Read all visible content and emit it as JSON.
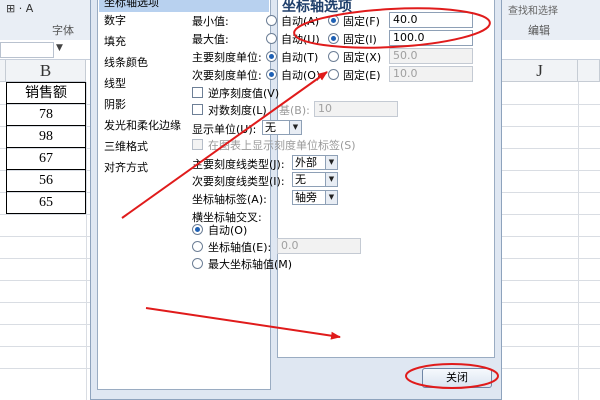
{
  "ribbon": {
    "font_group": "字体",
    "edit_group": "编辑",
    "right_mini": "查找和选择"
  },
  "sheet": {
    "col_b": "B",
    "col_j": "J",
    "header_cell": "销售额",
    "values": [
      "78",
      "98",
      "67",
      "56",
      "65"
    ]
  },
  "dialog": {
    "title": "坐标轴选项",
    "nav": [
      "坐标轴选项",
      "数字",
      "填充",
      "线条颜色",
      "线型",
      "阴影",
      "发光和柔化边缘",
      "三维格式",
      "对齐方式"
    ],
    "min_label": "最小值:",
    "max_label": "最大值:",
    "major_unit_label": "主要刻度单位:",
    "minor_unit_label": "次要刻度单位:",
    "auto_a": "自动(A)",
    "auto_u": "自动(U)",
    "auto_t": "自动(T)",
    "auto_o": "自动(O)",
    "fixed_f": "固定(F)",
    "fixed_i": "固定(I)",
    "fixed_x": "固定(X)",
    "fixed_e": "固定(E)",
    "min_value": "40.0",
    "max_value": "100.0",
    "major_value": "50.0",
    "minor_value": "10.0",
    "reverse_label": "逆序刻度值(V)",
    "log_label": "对数刻度(L)",
    "base_label": "基(B):",
    "base_value": "10",
    "display_units_label": "显示单位(U):",
    "display_units_value": "无",
    "show_units_label": "在图表上显示刻度单位标签(S)",
    "major_tick_label": "主要刻度线类型(J):",
    "major_tick_value": "外部",
    "minor_tick_label": "次要刻度线类型(I):",
    "minor_tick_value": "无",
    "axis_label_label": "坐标轴标签(A):",
    "axis_label_value": "轴旁",
    "cross_label": "横坐标轴交叉:",
    "cross_auto": "自动(O)",
    "cross_value_label": "坐标轴值(E):",
    "cross_value": "0.0",
    "cross_max": "最大坐标轴值(M)",
    "close_button": "关闭"
  },
  "colors": {
    "annotation": "#e01b1b",
    "selection": "#b8d1ef",
    "radio_dot": "#1e60b4"
  }
}
